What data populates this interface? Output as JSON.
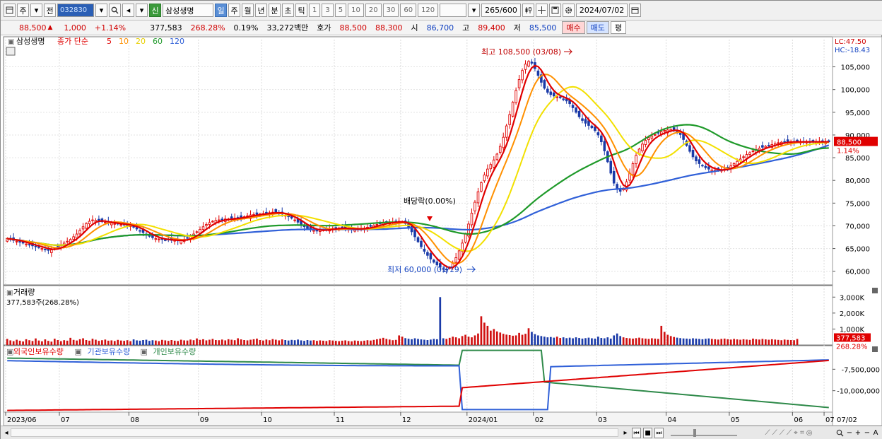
{
  "toolbar": {
    "market_btn": "주",
    "prev_btn": "전",
    "code": "032830",
    "stock_badge": "신",
    "stock_name": "삼성생명",
    "periods": [
      "일",
      "주",
      "월",
      "년",
      "분",
      "초",
      "틱"
    ],
    "active_period": "일",
    "intervals": [
      "1",
      "3",
      "5",
      "10",
      "20",
      "30",
      "60",
      "120"
    ],
    "count": "265",
    "count_max": "/600",
    "date": "2024/07/02"
  },
  "quote": {
    "price": "88,500",
    "change": "1,000",
    "change_rate": "+1.14%",
    "volume": "377,583",
    "vol_ratio": "268.28%",
    "turnover_rate": "0.19%",
    "amount": "33,272백만",
    "bid_label": "호가",
    "ask": "88,500",
    "bid": "88,300",
    "open_label": "시",
    "open": "86,700",
    "high_label": "고",
    "high": "89,400",
    "low_label": "저",
    "low": "85,500",
    "buy_btn": "매수",
    "sell_btn": "매도",
    "avg_btn": "평"
  },
  "colors": {
    "up": "#e00000",
    "down": "#1a3aa8",
    "ma5": "#e00000",
    "ma10": "#ff9000",
    "ma20": "#f2e000",
    "ma60": "#1f9a2a",
    "ma120": "#3060d8",
    "volume_up": "#d01010",
    "volume_down": "#1a3aa8",
    "foreign": "#e00000",
    "inst": "#3060d8",
    "indiv": "#2f8a4a"
  },
  "chart_data": [
    {
      "type": "candlestick",
      "series_label": "삼성생명",
      "legend": [
        {
          "name": "종가 단순",
          "color": "#e00000"
        },
        {
          "name": "5",
          "color": "#e00000"
        },
        {
          "name": "10",
          "color": "#ff9000"
        },
        {
          "name": "20",
          "color": "#e8d000"
        },
        {
          "name": "60",
          "color": "#1f9a2a"
        },
        {
          "name": "120",
          "color": "#3060d8"
        }
      ],
      "x_ticks": [
        "2023/06",
        "07",
        "08",
        "09",
        "10",
        "11",
        "12",
        "2024/01",
        "02",
        "03",
        "04",
        "05",
        "06",
        "07"
      ],
      "x_edge_label": "07/02",
      "ylim": [
        57000,
        111000
      ],
      "y_ticks": [
        60000,
        65000,
        70000,
        75000,
        80000,
        85000,
        90000,
        95000,
        100000,
        105000
      ],
      "y_tick_labels": [
        "60,000",
        "65,000",
        "70,000",
        "75,000",
        "80,000",
        "85,000",
        "90,000",
        "95,000",
        "100,000",
        "105,000"
      ],
      "corner_labels": [
        "LC:47.50",
        "HC:-18.43"
      ],
      "last_price_tag": "88,500",
      "last_rate_tag": "1.14%",
      "annotations": [
        {
          "text": "최고 108,500 (03/08)",
          "value": 108500
        },
        {
          "text": "최저 60,000 (01/19)",
          "value": 60000
        },
        {
          "text": "배당락(0.00%)",
          "value": 71000
        }
      ],
      "close": [
        67200,
        67000,
        66800,
        66600,
        66400,
        66200,
        66000,
        65800,
        65600,
        65400,
        65200,
        65000,
        64800,
        64600,
        64700,
        65000,
        65400,
        65800,
        66200,
        66600,
        67000,
        67600,
        68200,
        69000,
        69800,
        70500,
        71000,
        71300,
        71200,
        71000,
        70900,
        70800,
        70700,
        70600,
        70500,
        70400,
        70300,
        70200,
        70100,
        70000,
        69700,
        69300,
        68900,
        68500,
        68100,
        67700,
        67400,
        67200,
        67100,
        67000,
        66900,
        66900,
        66800,
        66800,
        66700,
        66800,
        67000,
        67300,
        67700,
        68200,
        68700,
        69200,
        69800,
        70300,
        70700,
        71000,
        71200,
        71300,
        71400,
        71500,
        71500,
        71600,
        71700,
        71800,
        71900,
        72000,
        72200,
        72400,
        72500,
        72500,
        72600,
        72700,
        72800,
        72900,
        73000,
        72900,
        72800,
        72600,
        72300,
        72000,
        71700,
        71300,
        70800,
        70300,
        69800,
        69400,
        69100,
        69000,
        69000,
        69000,
        69100,
        69200,
        69300,
        69400,
        69500,
        69500,
        69500,
        69400,
        69300,
        69300,
        69300,
        69300,
        69400,
        69500,
        69700,
        69900,
        70100,
        70300,
        70500,
        70600,
        70700,
        70800,
        70800,
        70900,
        71000,
        70900,
        70500,
        69700,
        68700,
        67600,
        66500,
        65400,
        64400,
        63500,
        62700,
        62000,
        61400,
        60900,
        60500,
        60400,
        60800,
        61700,
        63000,
        64500,
        66200,
        68200,
        70400,
        72800,
        75200,
        77500,
        79500,
        81200,
        82500,
        83500,
        84500,
        85800,
        87500,
        89500,
        92000,
        94500,
        97200,
        99800,
        102200,
        104200,
        105600,
        106200,
        105800,
        104600,
        103100,
        101600,
        100300,
        99400,
        98900,
        98600,
        98400,
        98200,
        97900,
        97500,
        96900,
        96000,
        95000,
        94000,
        93200,
        92600,
        92100,
        91600,
        91000,
        90000,
        88500,
        86500,
        84100,
        81600,
        79400,
        78000,
        77600,
        78200,
        79700,
        81600,
        83700,
        85500,
        86900,
        88000,
        88800,
        89400,
        89800,
        90100,
        90400,
        90700,
        91000,
        91100,
        91200,
        91100,
        90800,
        90100,
        89000,
        87700,
        86400,
        85200,
        84300,
        83700,
        83200,
        82800,
        82500,
        82300,
        82200,
        82200,
        82300,
        82500,
        82800,
        83200,
        83700,
        84200,
        84700,
        85200,
        85700,
        86100,
        86500,
        86800,
        87100,
        87300,
        87500,
        87700,
        87900,
        88100,
        88300,
        88400,
        88500,
        88500,
        88500,
        88500,
        88500,
        88500,
        88500,
        88500,
        88500,
        88500,
        88500,
        88500,
        88500,
        88500,
        88500
      ]
    },
    {
      "type": "bar",
      "series_label": "거래량",
      "sub_label": "377,583주(268.28%)",
      "ylim": [
        0,
        3500000
      ],
      "y_ticks": [
        1000000,
        2000000,
        3000000
      ],
      "y_tick_labels": [
        "1,000K",
        "2,000K",
        "3,000K"
      ],
      "last_tag": "377,583",
      "last_rate": "268.28%",
      "spike": {
        "label": "2024/01",
        "value": 3000000
      },
      "values": [
        380000,
        290000,
        240000,
        330000,
        270000,
        220000,
        360000,
        300000,
        250000,
        410000,
        280000,
        230000,
        350000,
        260000,
        210000,
        390000,
        310000,
        240000,
        300000,
        270000,
        450000,
        320000,
        280000,
        360000,
        420000,
        310000,
        270000,
        390000,
        330000,
        260000,
        300000,
        340000,
        270000,
        290000,
        250000,
        320000,
        280000,
        260000,
        300000,
        240000,
        350000,
        290000,
        270000,
        310000,
        330000,
        260000,
        300000,
        280000,
        240000,
        320000,
        290000,
        260000,
        310000,
        270000,
        250000,
        330000,
        290000,
        280000,
        340000,
        300000,
        410000,
        320000,
        360000,
        290000,
        330000,
        380000,
        310000,
        300000,
        340000,
        290000,
        360000,
        330000,
        300000,
        420000,
        350000,
        310000,
        290000,
        330000,
        360000,
        400000,
        310000,
        280000,
        340000,
        300000,
        370000,
        330000,
        290000,
        350000,
        310000,
        280000,
        320000,
        300000,
        340000,
        290000,
        260000,
        310000,
        280000,
        300000,
        260000,
        290000,
        270000,
        250000,
        300000,
        280000,
        260000,
        240000,
        270000,
        290000,
        250000,
        230000,
        280000,
        260000,
        240000,
        270000,
        300000,
        280000,
        320000,
        360000,
        400000,
        450000,
        380000,
        340000,
        300000,
        320000,
        600000,
        520000,
        430000,
        390000,
        360000,
        420000,
        380000,
        350000,
        330000,
        310000,
        340000,
        380000,
        360000,
        3000000,
        420000,
        380000,
        450000,
        520000,
        480000,
        420000,
        560000,
        640000,
        520000,
        480000,
        600000,
        720000,
        1800000,
        1400000,
        1200000,
        900000,
        1000000,
        850000,
        780000,
        700000,
        650000,
        620000,
        580000,
        600000,
        760000,
        640000,
        700000,
        1050000,
        820000,
        680000,
        600000,
        560000,
        520000,
        480000,
        500000,
        460000,
        520000,
        440000,
        480000,
        430000,
        460000,
        420000,
        480000,
        440000,
        400000,
        430000,
        460000,
        420000,
        400000,
        520000,
        440000,
        420000,
        480000,
        400000,
        600000,
        720000,
        560000,
        480000,
        440000,
        420000,
        400000,
        430000,
        460000,
        420000,
        400000,
        380000,
        420000,
        400000,
        380000,
        1200000,
        820000,
        640000,
        560000,
        500000,
        460000,
        430000,
        410000,
        400000,
        380000,
        420000,
        400000,
        380000,
        360000,
        390000,
        410000,
        380000,
        360000,
        340000,
        380000,
        400000,
        360000,
        340000,
        380000,
        350000,
        330000,
        360000,
        340000,
        320000,
        400000,
        360000,
        340000,
        380000,
        350000,
        330000,
        360000,
        340000,
        320000,
        300000,
        340000,
        320000,
        310000,
        300000,
        377583
      ]
    },
    {
      "type": "line",
      "series": [
        {
          "name": "외국인보유수량",
          "color": "#e00000"
        },
        {
          "name": "기관보유수량",
          "color": "#3060d8"
        },
        {
          "name": "개인보유수량",
          "color": "#2f8a4a"
        }
      ],
      "ylim": [
        -12500000,
        -5000000
      ],
      "y_ticks": [
        -7500000,
        -10000000
      ],
      "y_tick_labels": [
        "-7,500,000",
        "-10,000,000"
      ]
    }
  ],
  "bottom": {
    "plus": "+",
    "minus": "−",
    "a": "A"
  }
}
